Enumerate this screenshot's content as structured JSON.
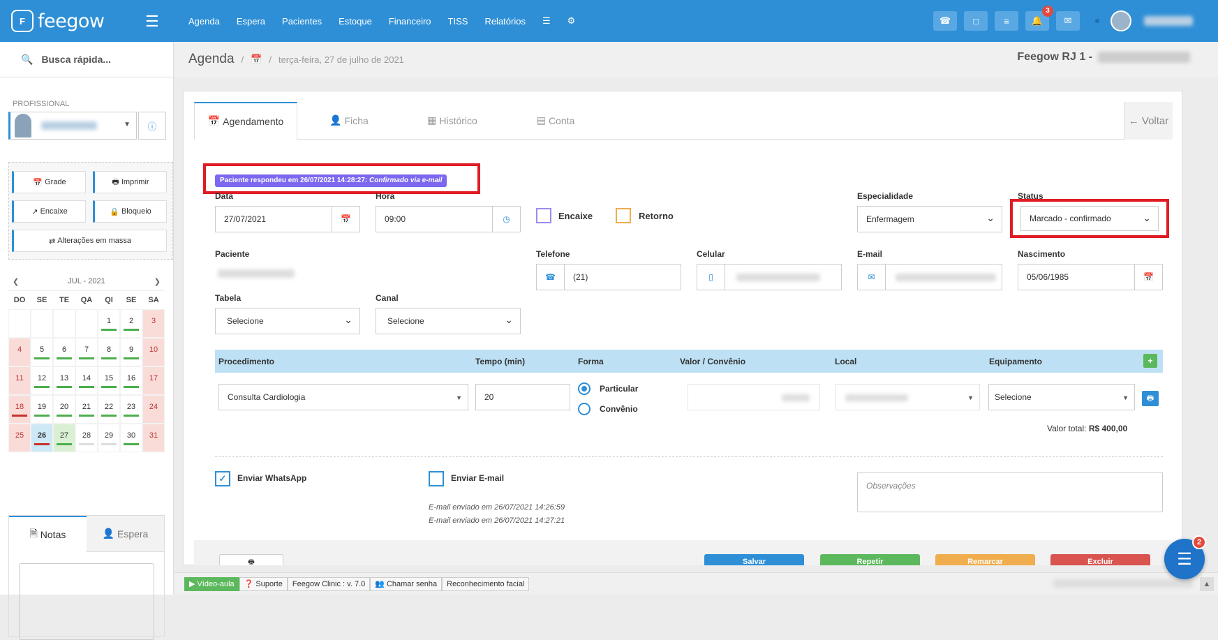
{
  "app": {
    "name": "feegow",
    "logo_mark": "F"
  },
  "nav": {
    "items": [
      "Agenda",
      "Espera",
      "Pacientes",
      "Estoque",
      "Financeiro",
      "TISS",
      "Relatórios"
    ]
  },
  "top_icons": {
    "notifications_count": "3"
  },
  "sidebar": {
    "quick_search": "Busca rápida...",
    "professional_label": "PROFISSIONAL",
    "buttons": {
      "grade": "Grade",
      "imprimir": "Imprimir",
      "encaixe": "Encaixe",
      "bloqueio": "Bloqueio",
      "alteracoes": "Alterações em massa"
    },
    "calendar": {
      "month": "JUL - 2021",
      "dow": [
        "DO",
        "SE",
        "TE",
        "QA",
        "QI",
        "SE",
        "SA"
      ],
      "days": [
        "1",
        "2",
        "3",
        "4",
        "5",
        "6",
        "7",
        "8",
        "9",
        "10",
        "11",
        "12",
        "13",
        "14",
        "15",
        "16",
        "17",
        "18",
        "19",
        "20",
        "21",
        "22",
        "23",
        "24",
        "25",
        "26",
        "27",
        "28",
        "29",
        "30",
        "31"
      ]
    },
    "notes_tabs": {
      "notas": "Notas",
      "espera": "Espera"
    }
  },
  "breadcrumb": {
    "title": "Agenda",
    "date": "terça-feira, 27 de julho de 2021"
  },
  "unit": {
    "name": "Feegow RJ 1 -"
  },
  "tabs": {
    "agendamento": "Agendamento",
    "ficha": "Ficha",
    "historico": "Histórico",
    "conta": "Conta",
    "voltar": "Voltar"
  },
  "response": {
    "prefix": "Paciente respondeu em 26/07/2021 14:28:27:",
    "detail": "Confirmado via e-mail"
  },
  "form": {
    "data_label": "Data",
    "data_value": "27/07/2021",
    "hora_label": "Hora",
    "hora_value": "09:00",
    "encaixe": "Encaixe",
    "retorno": "Retorno",
    "especialidade_label": "Especialidade",
    "especialidade_value": "Enfermagem",
    "status_label": "Status",
    "status_value": "Marcado - confirmado",
    "paciente_label": "Paciente",
    "telefone_label": "Telefone",
    "telefone_value": "(21)",
    "celular_label": "Celular",
    "email_label": "E-mail",
    "nascimento_label": "Nascimento",
    "nascimento_value": "05/06/1985",
    "tabela_label": "Tabela",
    "tabela_value": "Selecione",
    "canal_label": "Canal",
    "canal_value": "Selecione"
  },
  "procedures": {
    "headers": [
      "Procedimento",
      "Tempo (min)",
      "Forma",
      "Valor / Convênio",
      "Local",
      "Equipamento"
    ],
    "procedimento": "Consulta Cardiologia",
    "tempo": "20",
    "forma_particular": "Particular",
    "forma_convenio": "Convênio",
    "equipamento": "Selecione",
    "total_label": "Valor total:",
    "total_value": "R$ 400,00"
  },
  "messages": {
    "whatsapp": "Enviar WhatsApp",
    "email": "Enviar E-mail",
    "email_log_1": "E-mail enviado em 26/07/2021 14:26:59",
    "email_log_2": "E-mail enviado em 26/07/2021 14:27:21",
    "observacoes_placeholder": "Observações"
  },
  "footer_buttons": {
    "salvar": "Salvar",
    "repetir": "Repetir",
    "remarcar": "Remarcar",
    "excluir": "Excluir"
  },
  "statusbar": {
    "video": "Vídeo-aula",
    "suporte": "Suporte",
    "version": "Feegow Clinic : v. 7.0",
    "chamar": "Chamar senha",
    "reconhecimento": "Reconhecimento facial"
  },
  "chat": {
    "badge": "2"
  },
  "colors": {
    "brand": "#2e8fd6",
    "highlight": "#e01b24",
    "response_badge": "#7b68ee"
  }
}
